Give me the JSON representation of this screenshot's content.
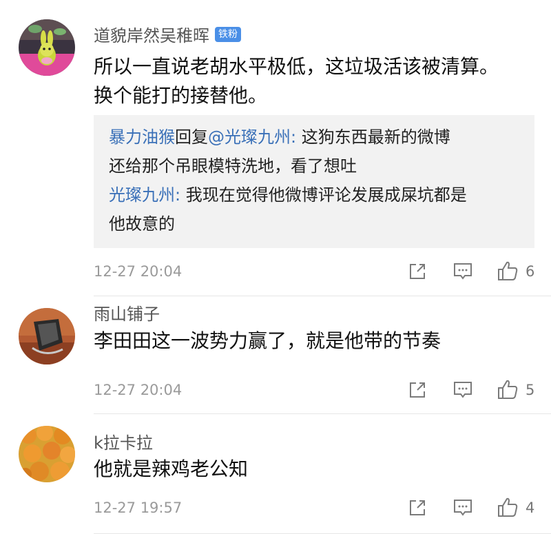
{
  "comments": [
    {
      "username": "道貌岸然吴稚晖",
      "badge": "铁粉",
      "text_line1": "所以一直说老胡水平极低，这垃圾活该被清算。",
      "text_line2": "换个能打的接替他。",
      "replies": [
        {
          "author": "暴力油猴",
          "reply_word": "回复",
          "mention": "@光璨九州",
          "sep": ": ",
          "line1": "这狗东西最新的微博",
          "line2": "还给那个吊眼模特洗地，看了想吐"
        },
        {
          "author": "光璨九州",
          "sep": ": ",
          "line1": "我现在觉得他微博评论发展成屎坑都是",
          "line2": "他故意的"
        }
      ],
      "time": "12-27 20:04",
      "likes": "6"
    },
    {
      "username": "雨山铺子",
      "text": "李田田这一波势力赢了，就是他带的节奏",
      "time": "12-27 20:04",
      "likes": "5"
    },
    {
      "username": "k拉卡拉",
      "text": "他就是辣鸡老公知",
      "time": "12-27 19:57",
      "likes": "4"
    }
  ],
  "icons": {
    "forward": "forward-icon",
    "comment": "comment-icon",
    "like": "thumbs-up-icon"
  },
  "colors": {
    "link": "#3a70b8",
    "badge": "#4a8fe7",
    "meta": "#9a9a9a"
  }
}
